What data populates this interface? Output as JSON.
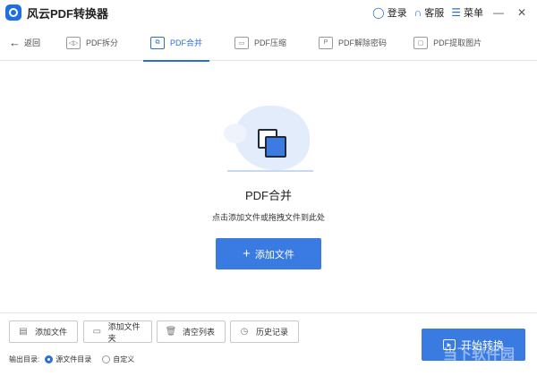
{
  "app": {
    "title": "风云PDF转换器"
  },
  "titlebar": {
    "login": "登录",
    "service": "客服",
    "menu": "菜单",
    "minimize": "—",
    "close": "✕"
  },
  "tabbar": {
    "back": "返回",
    "tabs": [
      {
        "label": "PDF拆分",
        "icon": "split-icon",
        "glyph": "◁▷"
      },
      {
        "label": "PDF合并",
        "icon": "merge-icon",
        "glyph": "⧉",
        "active": true
      },
      {
        "label": "PDF压缩",
        "icon": "compress-icon",
        "glyph": "▭"
      },
      {
        "label": "PDF解除密码",
        "icon": "unlock-icon",
        "glyph": "P"
      },
      {
        "label": "PDF提取图片",
        "icon": "image-extract-icon",
        "glyph": "▢"
      }
    ]
  },
  "main": {
    "title": "PDF合并",
    "subtitle": "点击添加文件或拖拽文件到此处",
    "add_button": "添加文件",
    "add_plus": "+"
  },
  "bottom": {
    "buttons": [
      {
        "label": "添加文件",
        "icon": "add-file-icon",
        "glyph": "▤"
      },
      {
        "label": "添加文件夹",
        "icon": "add-folder-icon",
        "glyph": "▭"
      },
      {
        "label": "清空列表",
        "icon": "trash-icon",
        "glyph": "🗑"
      },
      {
        "label": "历史记录",
        "icon": "history-icon",
        "glyph": "◷"
      }
    ],
    "output_label": "输出目录:",
    "output_options": [
      {
        "label": "源文件目录",
        "selected": true
      },
      {
        "label": "自定义",
        "selected": false
      }
    ],
    "start_button": "开始转换",
    "watermark": "当下软件园"
  },
  "colors": {
    "accent": "#3a7be2",
    "tab_active": "#2b6fd6"
  }
}
